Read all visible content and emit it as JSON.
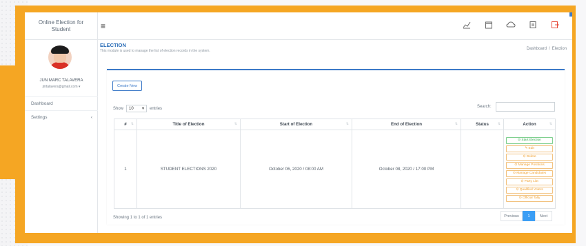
{
  "app": {
    "title": "Online Election for Student"
  },
  "user": {
    "name": "JUN MARC TALAVERA",
    "email": "jmtalavera@gmail.com ▾"
  },
  "sidebar": {
    "items": [
      {
        "label": "Dashboard",
        "arrow": ""
      },
      {
        "label": "Settings",
        "arrow": "‹"
      }
    ]
  },
  "topbar": {
    "menu_icon": "≡",
    "icons": [
      "chart-icon",
      "calendar-icon",
      "cloud-icon",
      "printer-icon",
      "logout-icon"
    ]
  },
  "page": {
    "title": "ELECTION",
    "subtitle": "This module is used to manage the list of election records in the system.",
    "breadcrumb": [
      "Dashboard",
      "Election"
    ]
  },
  "card": {
    "create_label": "Create New",
    "show_label": "Show",
    "entries_value": "10",
    "entries_label": "entries",
    "search_label": "Search:",
    "columns": [
      "#",
      "Title of Election",
      "Start of Election",
      "End of Election",
      "Status",
      "Action"
    ],
    "rows": [
      {
        "num": "1",
        "title": "STUDENT ELECTIONS 2020",
        "start": "October 06, 2020 / 08:00 AM",
        "end": "October 08, 2020 / 17:00 PM",
        "status": "",
        "actions": [
          {
            "label": "⊙ Start Election",
            "color": "green"
          },
          {
            "label": "✎ Edit",
            "color": "orange"
          },
          {
            "label": "⊙ Delete",
            "color": "orange"
          },
          {
            "label": "⊙ Manage Positions",
            "color": "orange"
          },
          {
            "label": "⊙ Manage Candidates",
            "color": "orange"
          },
          {
            "label": "⊙ Party List",
            "color": "orange"
          },
          {
            "label": "⊙ Qualified Voters",
            "color": "orange"
          },
          {
            "label": "⊙ Official Tally",
            "color": "orange"
          }
        ]
      }
    ],
    "info": "Showing 1 to 1 of 1 entries",
    "pagination": {
      "prev": "Previous",
      "page": "1",
      "next": "Next"
    }
  }
}
